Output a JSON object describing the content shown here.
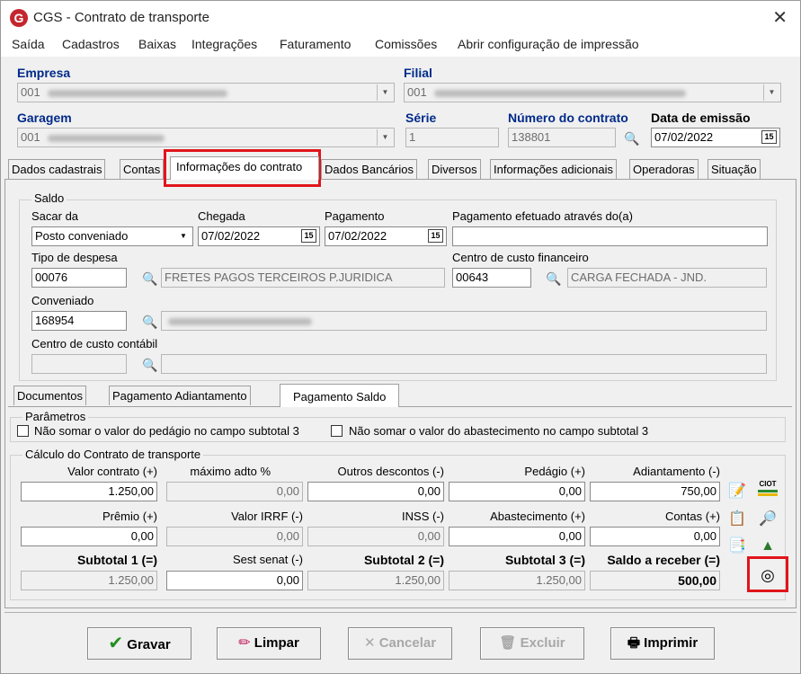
{
  "window": {
    "title": "CGS - Contrato de transporte",
    "logo": "G"
  },
  "menu": [
    "Saída",
    "Cadastros",
    "Baixas",
    "Integrações",
    "Faturamento",
    "Comissões",
    "Abrir configuração de impressão"
  ],
  "header": {
    "empresa_label": "Empresa",
    "empresa_value": "001",
    "filial_label": "Filial",
    "filial_value": "001",
    "garagem_label": "Garagem",
    "garagem_value": "001",
    "serie_label": "Série",
    "serie_value": "1",
    "numero_label": "Número do contrato",
    "numero_value": "138801",
    "data_label": "Data de emissão",
    "data_value": "07/02/2022",
    "cal_icon": "15"
  },
  "tabs": [
    "Dados cadastrais",
    "Contas",
    "Informações do contrato",
    "Dados Bancários",
    "Diversos",
    "Informações adicionais",
    "Operadoras",
    "Situação"
  ],
  "saldo": {
    "group_title": "Saldo",
    "sacar_label": "Sacar da",
    "sacar_value": "Posto conveniado",
    "chegada_label": "Chegada",
    "chegada_value": "07/02/2022",
    "pagamento_label": "Pagamento",
    "pagamento_value": "07/02/2022",
    "pag_via_label": "Pagamento efetuado através do(a)",
    "pag_via_value": "",
    "tipo_label": "Tipo de despesa",
    "tipo_code": "00076",
    "tipo_desc": "FRETES PAGOS TERCEIROS P.JURIDICA",
    "ccf_label": "Centro de custo financeiro",
    "ccf_code": "00643",
    "ccf_desc": "CARGA FECHADA - JND.",
    "conv_label": "Conveniado",
    "conv_code": "168954",
    "ccc_label": "Centro de custo contábil"
  },
  "subtabs": [
    "Documentos",
    "Pagamento Adiantamento",
    "Pagamento Saldo"
  ],
  "parametros": {
    "title": "Parâmetros",
    "opt1": "Não somar o valor do pedágio no campo subtotal 3",
    "opt2": "Não somar o valor do abastecimento no campo subtotal 3"
  },
  "calculo": {
    "title": "Cálculo do Contrato de transporte",
    "row1": [
      {
        "label": "Valor contrato (+)",
        "value": "1.250,00"
      },
      {
        "label": "máximo adto %",
        "value": "0,00"
      },
      {
        "label": "Outros descontos (-)",
        "value": "0,00"
      },
      {
        "label": "Pedágio (+)",
        "value": "0,00"
      },
      {
        "label": "Adiantamento (-)",
        "value": "750,00"
      }
    ],
    "row2": [
      {
        "label": "Prêmio (+)",
        "value": "0,00"
      },
      {
        "label": "Valor IRRF (-)",
        "value": "0,00"
      },
      {
        "label": "INSS (-)",
        "value": "0,00"
      },
      {
        "label": "Abastecimento (+)",
        "value": "0,00"
      },
      {
        "label": "Contas (+)",
        "value": "0,00"
      }
    ],
    "row3": [
      {
        "label": "Subtotal 1 (=)",
        "value": "1.250,00"
      },
      {
        "label": "Sest senat (-)",
        "value": "0,00"
      },
      {
        "label": "Subtotal 2 (=)",
        "value": "1.250,00"
      },
      {
        "label": "Subtotal 3 (=)",
        "value": "1.250,00"
      },
      {
        "label": "Saldo a receber (=)",
        "value": "500,00"
      }
    ],
    "ciot_label": "CIOT"
  },
  "buttons": {
    "gravar": "Gravar",
    "limpar": "Limpar",
    "cancelar": "Cancelar",
    "excluir": "Excluir",
    "imprimir": "Imprimir"
  },
  "colors": {
    "accent_label": "#002a8a",
    "highlight": "#e0151b"
  }
}
